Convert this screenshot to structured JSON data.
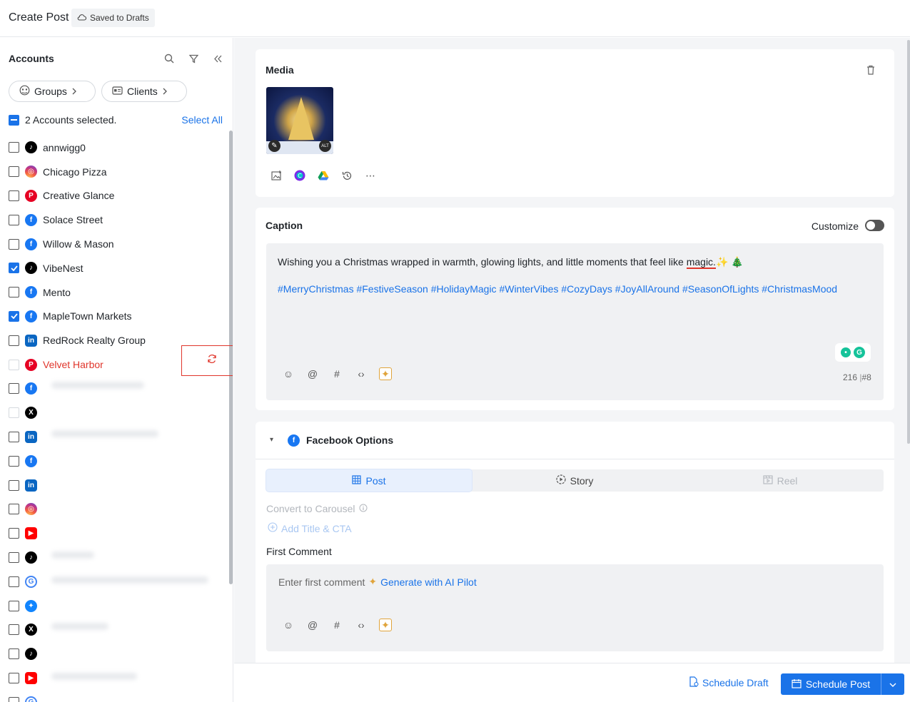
{
  "header": {
    "title": "Create Post",
    "saved_label": "Saved to Drafts"
  },
  "accounts": {
    "title": "Accounts",
    "groups_label": "Groups",
    "clients_label": "Clients",
    "selected_text": "2 Accounts selected.",
    "select_all": "Select All",
    "items": [
      {
        "label": "annwigg0",
        "platform": "tiktok",
        "checked": false
      },
      {
        "label": "Chicago Pizza",
        "platform": "instagram",
        "checked": false
      },
      {
        "label": "Creative Glance",
        "platform": "pinterest",
        "checked": false
      },
      {
        "label": "Solace Street",
        "platform": "facebook",
        "checked": false
      },
      {
        "label": "Willow & Mason",
        "platform": "facebook",
        "checked": false
      },
      {
        "label": "VibeNest",
        "platform": "tiktok",
        "checked": true
      },
      {
        "label": "Mento",
        "platform": "facebook",
        "checked": false
      },
      {
        "label": "MapleTown Markets",
        "platform": "facebook",
        "checked": true
      },
      {
        "label": "RedRock Realty Group",
        "platform": "linkedin",
        "checked": false
      },
      {
        "label": "Velvet Harbor",
        "platform": "pinterest",
        "checked": false,
        "error": true
      }
    ]
  },
  "media": {
    "title": "Media"
  },
  "caption": {
    "title": "Caption",
    "customize_label": "Customize",
    "text_before": "Wishing you a Christmas wrapped in warmth, glowing lights, and little moments that feel like ",
    "text_magic": "magic.",
    "text_emoji": "✨ 🎄",
    "hashtags": "#MerryChristmas #FestiveSeason #HolidayMagic #WinterVibes #CozyDays #JoyAllAround #SeasonOfLights #ChristmasMood",
    "char_count": "216",
    "hash_count": "#8"
  },
  "facebook": {
    "title": "Facebook Options",
    "tabs": [
      {
        "label": "Post"
      },
      {
        "label": "Story"
      },
      {
        "label": "Reel"
      }
    ],
    "convert_label": "Convert to Carousel",
    "add_title_label": "Add Title & CTA",
    "first_comment_label": "First Comment",
    "comment_placeholder": "Enter first comment",
    "generate_label": "Generate with AI Pilot"
  },
  "footer": {
    "draft_label": "Schedule Draft",
    "post_label": "Schedule Post"
  },
  "colors": {
    "accent": "#1a73e8",
    "error": "#e0352b",
    "ai": "#e0a43b"
  }
}
